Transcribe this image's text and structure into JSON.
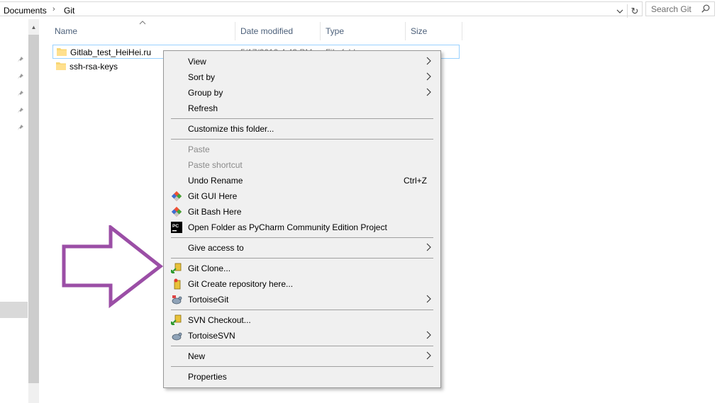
{
  "address_bar": {
    "crumbs": [
      "Documents",
      "Git"
    ],
    "search_placeholder": "Search Git"
  },
  "file_list": {
    "columns": [
      "Name",
      "Date modified",
      "Type",
      "Size"
    ],
    "rows": [
      {
        "name": "Gitlab_test_HeiHei.ru",
        "date": "5/17/2019 4:43 PM",
        "type": "File folder"
      },
      {
        "name": "ssh-rsa-keys"
      }
    ]
  },
  "context_menu": {
    "items": [
      {
        "label": "View",
        "submenu": true
      },
      {
        "label": "Sort by",
        "submenu": true
      },
      {
        "label": "Group by",
        "submenu": true
      },
      {
        "label": "Refresh"
      },
      {
        "label": "Customize this folder..."
      },
      {
        "label": "Paste",
        "disabled": true
      },
      {
        "label": "Paste shortcut",
        "disabled": true
      },
      {
        "label": "Undo Rename",
        "shortcut": "Ctrl+Z"
      },
      {
        "label": "Git GUI Here",
        "icon": "git-icon"
      },
      {
        "label": "Git Bash Here",
        "icon": "git-icon"
      },
      {
        "label": "Open Folder as PyCharm Community Edition Project",
        "icon": "pycharm-icon"
      },
      {
        "label": "Give access to",
        "submenu": true
      },
      {
        "label": "Git Clone...",
        "icon": "tortoisegit-clone-icon"
      },
      {
        "label": "Git Create repository here...",
        "icon": "tortoisegit-create-repo-icon"
      },
      {
        "label": "TortoiseGit",
        "icon": "tortoisegit-icon",
        "submenu": true
      },
      {
        "label": "SVN Checkout...",
        "icon": "svn-checkout-icon"
      },
      {
        "label": "TortoiseSVN",
        "icon": "tortoisesvn-icon",
        "submenu": true
      },
      {
        "label": "New",
        "submenu": true
      },
      {
        "label": "Properties"
      }
    ]
  },
  "colors": {
    "annotation_arrow": "#9b4ea6",
    "selection_border": "#99d1ff",
    "menu_bg": "#f0f0f0"
  }
}
